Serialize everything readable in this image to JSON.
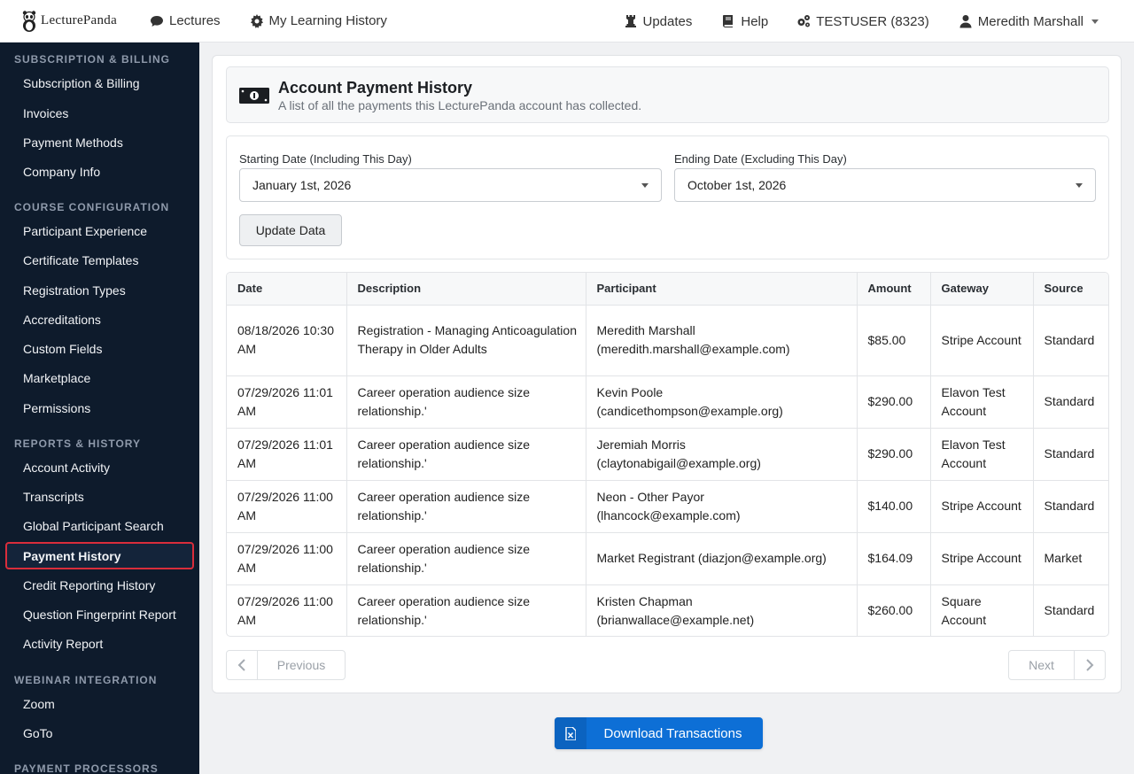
{
  "navbar": {
    "brand": "LecturePanda",
    "lectures": "Lectures",
    "learning_history": "My Learning History",
    "updates": "Updates",
    "help": "Help",
    "account": "TESTUSER (8323)",
    "user": "Meredith Marshall"
  },
  "sidebar": {
    "sections": [
      {
        "title": "Subscription & Billing",
        "items": [
          "Subscription & Billing",
          "Invoices",
          "Payment Methods",
          "Company Info"
        ]
      },
      {
        "title": "Course Configuration",
        "items": [
          "Participant Experience",
          "Certificate Templates",
          "Registration Types",
          "Accreditations",
          "Custom Fields",
          "Marketplace",
          "Permissions"
        ]
      },
      {
        "title": "Reports & History",
        "items": [
          "Account Activity",
          "Transcripts",
          "Global Participant Search",
          "Payment History",
          "Credit Reporting History",
          "Question Fingerprint Report",
          "Activity Report"
        ]
      },
      {
        "title": "Webinar Integration",
        "items": [
          "Zoom",
          "GoTo"
        ]
      },
      {
        "title": "Payment Processors",
        "items": []
      }
    ],
    "active_item": "Payment History"
  },
  "header": {
    "title": "Account Payment History",
    "subtitle": "A list of all the payments this LecturePanda account has collected."
  },
  "filters": {
    "start_label": "Starting Date (Including This Day)",
    "start_value": "January 1st, 2026",
    "end_label": "Ending Date (Excluding This Day)",
    "end_value": "October 1st, 2026",
    "update_button": "Update Data"
  },
  "table": {
    "columns": [
      "Date",
      "Description",
      "Participant",
      "Amount",
      "Gateway",
      "Source"
    ],
    "rows": [
      {
        "date": "08/18/2026 10:30 AM",
        "description": "Registration - Managing Anticoagulation Therapy in Older Adults",
        "participant": "Meredith Marshall (meredith.marshall@example.com)",
        "amount": "$85.00",
        "gateway": "Stripe Account",
        "source": "Standard"
      },
      {
        "date": "07/29/2026 11:01 AM",
        "description": "Career operation audience size relationship.'",
        "participant": "Kevin Poole (candicethompson@example.org)",
        "amount": "$290.00",
        "gateway": "Elavon Test Account",
        "source": "Standard"
      },
      {
        "date": "07/29/2026 11:01 AM",
        "description": "Career operation audience size relationship.'",
        "participant": "Jeremiah Morris (claytonabigail@example.org)",
        "amount": "$290.00",
        "gateway": "Elavon Test Account",
        "source": "Standard"
      },
      {
        "date": "07/29/2026 11:00 AM",
        "description": "Career operation audience size relationship.'",
        "participant": "Neon - Other Payor (lhancock@example.com)",
        "amount": "$140.00",
        "gateway": "Stripe Account",
        "source": "Standard"
      },
      {
        "date": "07/29/2026 11:00 AM",
        "description": "Career operation audience size relationship.'",
        "participant": "Market Registrant (diazjon@example.org)",
        "amount": "$164.09",
        "gateway": "Stripe Account",
        "source": "Market"
      },
      {
        "date": "07/29/2026 11:00 AM",
        "description": "Career operation audience size relationship.'",
        "participant": "Kristen Chapman (brianwallace@example.net)",
        "amount": "$260.00",
        "gateway": "Square Account",
        "source": "Standard"
      }
    ]
  },
  "pagination": {
    "previous": "Previous",
    "next": "Next"
  },
  "download_button": "Download Transactions",
  "colors": {
    "sidebar_bg": "#0e1b2c",
    "active_border": "#d92d3b",
    "primary": "#0d6fd6"
  },
  "icons": {
    "lectures": "comment-icon",
    "learning_history": "gear-icon",
    "updates": "chess-rook-icon",
    "help": "book-icon",
    "account": "cogs-icon",
    "user": "user-icon",
    "header": "money-bill-icon",
    "download": "file-excel-icon"
  }
}
